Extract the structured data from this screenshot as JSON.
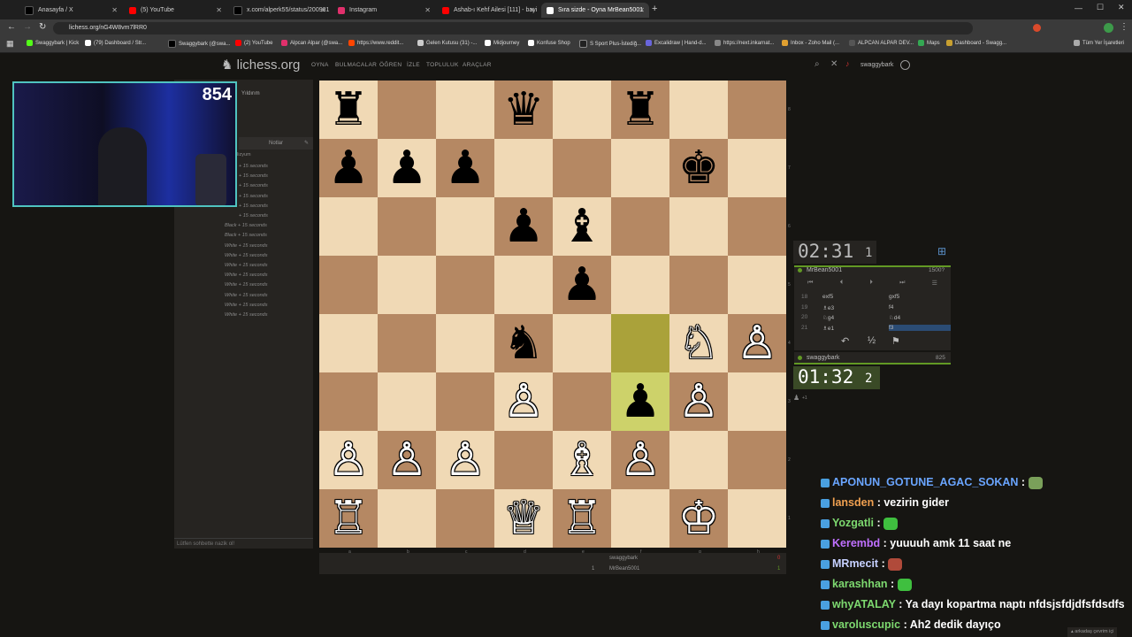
{
  "browser": {
    "tabs": [
      {
        "title": "Anasayfa / X",
        "color": "#000000"
      },
      {
        "title": "(5) YouTube",
        "color": "#ff0000"
      },
      {
        "title": "x.com/alperk55/status/200981",
        "color": "#000000"
      },
      {
        "title": "Instagram",
        "color": "#e1306c"
      },
      {
        "title": "Ashab-ı Kehf Ailesi [111] - bayi",
        "color": "#ff0000"
      },
      {
        "title": "Sıra sizde - Oyna MrBean5001",
        "color": "#ffffff"
      }
    ],
    "url": "lichess.org/nG4W8vm7lRR0",
    "bookmarks": [
      "Swaggybark | Kick",
      "(79) Dashboard / Str...",
      "Swaggybark (@swa...",
      "(2) YouTube",
      "Alpcan Alpar (@swa...",
      "https://www.reddit...",
      "Gelen Kutusu (31) -...",
      "Midjourney",
      "Konfuse Shop",
      "S Sport Plus-İstediğ...",
      "Excalidraw | Hand-d...",
      "https://next.inkarnat...",
      "Inbox - Zoho Mail (...",
      "ALPCAN ALPAR DEV...",
      "Maps",
      "Dashboard - Swagg..."
    ],
    "bookmarks_right": "Tüm Yer İşaretleri"
  },
  "site": {
    "logo": "lichess.org",
    "nav": [
      "OYNA",
      "BULMACALAR",
      "ÖĞREN",
      "İZLE",
      "TOPLULUK",
      "ARAÇLAR"
    ],
    "username": "swaggybark"
  },
  "left_panel": {
    "game_type": "Yıldırım",
    "notes_tab": "Notlar",
    "label_top": "lizyum",
    "chat_placeholder": "Lütfen sohbette nazik ol!",
    "moves_log": [
      "+ 15 seconds",
      "+ 15 seconds",
      "+ 15 seconds",
      "+ 15 seconds",
      "+ 15 seconds",
      "+ 15 seconds",
      "Black + 15 seconds",
      "Black + 15 seconds",
      "White + 15 seconds",
      "White + 15 seconds",
      "White + 15 seconds",
      "White + 15 seconds",
      "White + 15 seconds",
      "White + 15 seconds",
      "White + 15 seconds",
      "White + 15 seconds"
    ]
  },
  "webcam": {
    "viewer_count": "854"
  },
  "board": {
    "files": [
      "a",
      "b",
      "c",
      "d",
      "e",
      "f",
      "g",
      "h"
    ],
    "ranks": [
      "8",
      "7",
      "6",
      "5",
      "4",
      "3",
      "2",
      "1"
    ],
    "pieces": [
      [
        "♜",
        "",
        "",
        "♛",
        "",
        "♜",
        "",
        ""
      ],
      [
        "♟",
        "♟",
        "♟",
        "",
        "",
        "",
        "♚",
        ""
      ],
      [
        "",
        "",
        "",
        "♟",
        "♝",
        "",
        "",
        ""
      ],
      [
        "",
        "",
        "",
        "",
        "♟",
        "",
        "",
        ""
      ],
      [
        "",
        "",
        "",
        "♞",
        "",
        "",
        "♘",
        "♙"
      ],
      [
        "",
        "",
        "",
        "♙",
        "",
        "♟",
        "♙",
        ""
      ],
      [
        "♙",
        "♙",
        "♙",
        "",
        "♗",
        "♙",
        "",
        ""
      ],
      [
        "♖",
        "",
        "",
        "♕",
        "♖",
        "",
        "♔",
        ""
      ]
    ],
    "highlight_squares": [
      "f4",
      "f3"
    ]
  },
  "game": {
    "opponent_clock": "02:31",
    "opponent_clock_tenths": "1",
    "opponent_name": "MrBean5001",
    "opponent_rating": "1500?",
    "player_clock": "01:32",
    "player_clock_tenths": "2",
    "player_name": "swaggybark",
    "player_rating": "825",
    "moves": [
      {
        "n": "18",
        "w": "exf5",
        "b": "gxf5"
      },
      {
        "n": "19",
        "w": "♗e3",
        "b": "f4"
      },
      {
        "n": "20",
        "w": "♘g4",
        "b": "♘d4"
      },
      {
        "n": "21",
        "w": "♗e1",
        "b": "f3"
      }
    ],
    "draw_label": "½",
    "under_board": [
      {
        "name": "swaggybark",
        "score": "0"
      },
      {
        "name": "MrBean5001",
        "score": "1",
        "num": "1"
      }
    ],
    "spectators": "+1"
  },
  "chat": [
    {
      "user": "APONUN_GOTUNE_AGAC_SOKAN",
      "color": "#6aa5ff",
      "msg": "",
      "emote": "#7aa05a"
    },
    {
      "user": "lansden",
      "color": "#f0a050",
      "msg": "vezirin gider"
    },
    {
      "user": "Yozgatli",
      "color": "#7dd96f",
      "msg": "",
      "emote": "#3fbf3f"
    },
    {
      "user": "Kerembd",
      "color": "#c070ff",
      "msg": "yuuuuh amk 11 saat ne"
    },
    {
      "user": "MRmecit",
      "color": "#c6d0ff",
      "msg": "",
      "emote": "#b04a3a"
    },
    {
      "user": "karashhan",
      "color": "#7dd96f",
      "msg": "",
      "emote": "#3fbf3f"
    },
    {
      "user": "whyATALAY",
      "color": "#7dd96f",
      "msg": "Ya dayı kopartma naptı nfdsjsfdjdfsfdsdfs"
    },
    {
      "user": "varoluscupic",
      "color": "#7dd96f",
      "msg": "Ah2 dedik dayıço"
    }
  ],
  "footer_right": "arkadaş çevrim içi"
}
